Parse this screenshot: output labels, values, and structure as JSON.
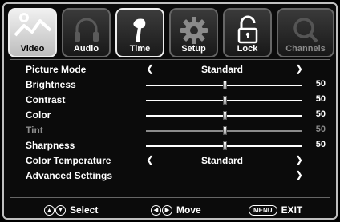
{
  "tabs": [
    {
      "label": "Video",
      "icon": "video-icon",
      "state": "selected"
    },
    {
      "label": "Audio",
      "icon": "headphones-icon",
      "state": "normal"
    },
    {
      "label": "Time",
      "icon": "microphone-icon",
      "state": "focused"
    },
    {
      "label": "Setup",
      "icon": "gear-icon",
      "state": "normal"
    },
    {
      "label": "Lock",
      "icon": "padlock-icon",
      "state": "normal"
    },
    {
      "label": "Channels",
      "icon": "search-icon",
      "state": "disabled"
    }
  ],
  "menu": {
    "picture_mode": {
      "label": "Picture Mode",
      "value": "Standard"
    },
    "brightness": {
      "label": "Brightness",
      "value": "50",
      "level": 0.5
    },
    "contrast": {
      "label": "Contrast",
      "value": "50",
      "level": 0.5
    },
    "color": {
      "label": "Color",
      "value": "50",
      "level": 0.5
    },
    "tint": {
      "label": "Tint",
      "value": "50",
      "level": 0.5,
      "disabled": true
    },
    "sharpness": {
      "label": "Sharpness",
      "value": "50",
      "level": 0.5
    },
    "color_temperature": {
      "label": "Color Temperature",
      "value": "Standard"
    },
    "advanced": {
      "label": "Advanced Settings"
    }
  },
  "footer": {
    "select_label": "Select",
    "move_label": "Move",
    "menu_key": "MENU",
    "exit_label": "EXIT"
  },
  "colors": {
    "background": "#000000",
    "text": "#ffffff",
    "disabled_text": "#8b8b8b",
    "border": "#bfbfbf"
  }
}
